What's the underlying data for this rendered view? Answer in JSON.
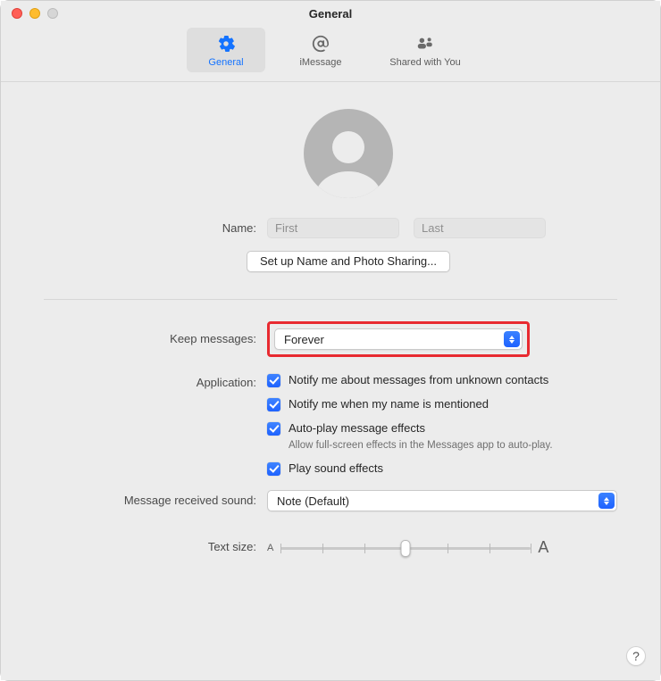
{
  "window": {
    "title": "General"
  },
  "toolbar": {
    "items": [
      {
        "label": "General"
      },
      {
        "label": "iMessage"
      },
      {
        "label": "Shared with You"
      }
    ]
  },
  "profile": {
    "name_label": "Name:",
    "first_placeholder": "First",
    "last_placeholder": "Last",
    "setup_button": "Set up Name and Photo Sharing..."
  },
  "settings": {
    "keep_messages": {
      "label": "Keep messages:",
      "value": "Forever"
    },
    "application": {
      "label": "Application:",
      "opts": [
        {
          "label": "Notify me about messages from unknown contacts"
        },
        {
          "label": "Notify me when my name is mentioned"
        },
        {
          "label": "Auto-play message effects",
          "helper": "Allow full-screen effects in the Messages app to auto-play."
        },
        {
          "label": "Play sound effects"
        }
      ]
    },
    "received_sound": {
      "label": "Message received sound:",
      "value": "Note (Default)"
    },
    "text_size": {
      "label": "Text size:"
    }
  },
  "help": {
    "symbol": "?"
  }
}
